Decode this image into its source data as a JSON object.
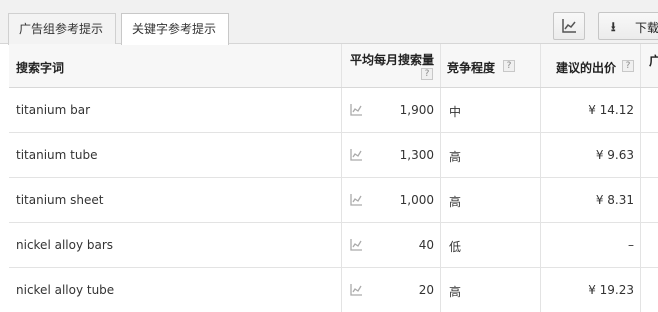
{
  "tabs": [
    {
      "label": "广告组参考提示",
      "active": false
    },
    {
      "label": "关键字参考提示",
      "active": true
    }
  ],
  "toolbar": {
    "chart_icon": "line-chart-icon",
    "download_icon": "download-icon",
    "download_label": "下载"
  },
  "table": {
    "headers": {
      "keyword": "搜索字词",
      "volume": "平均每月搜索量",
      "competition": "竞争程度",
      "bid": "建议的出价",
      "more": "广",
      "help": "?"
    },
    "rows": [
      {
        "keyword": "titanium bar",
        "volume": "1,900",
        "competition": "中",
        "bid": "¥ 14.12"
      },
      {
        "keyword": "titanium tube",
        "volume": "1,300",
        "competition": "高",
        "bid": "¥ 9.63"
      },
      {
        "keyword": "titanium sheet",
        "volume": "1,000",
        "competition": "高",
        "bid": "¥ 8.31"
      },
      {
        "keyword": "nickel alloy bars",
        "volume": "40",
        "competition": "低",
        "bid": "–"
      },
      {
        "keyword": "nickel alloy tube",
        "volume": "20",
        "competition": "高",
        "bid": "¥ 19.23"
      }
    ]
  }
}
